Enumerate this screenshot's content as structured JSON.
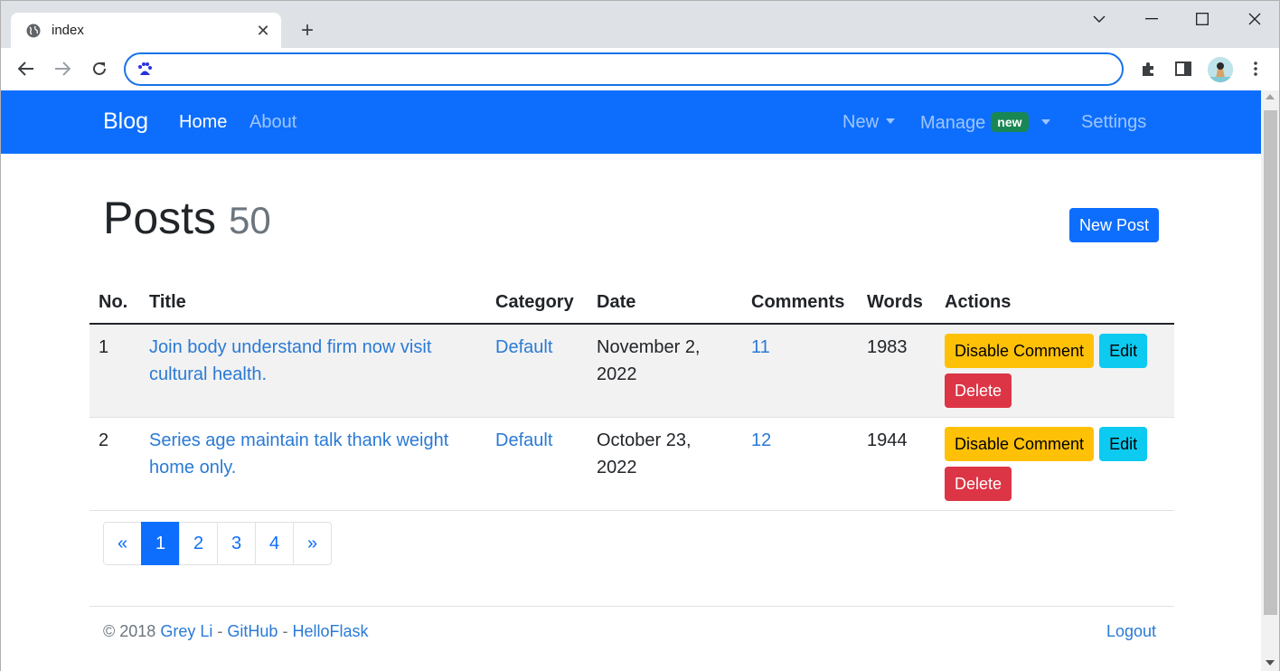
{
  "browser": {
    "tab_title": "index",
    "address_value": "",
    "address_placeholder": ""
  },
  "navbar": {
    "brand": "Blog",
    "home": "Home",
    "about": "About",
    "new": "New",
    "manage": "Manage",
    "manage_badge": "new",
    "settings": "Settings"
  },
  "heading": {
    "title": "Posts",
    "count": "50",
    "new_post_label": "New Post"
  },
  "table": {
    "headers": [
      "No.",
      "Title",
      "Category",
      "Date",
      "Comments",
      "Words",
      "Actions"
    ],
    "rows": [
      {
        "no": "1",
        "title": "Join body understand firm now visit cultural health.",
        "category": "Default",
        "date": "November 2, 2022",
        "comments": "11",
        "words": "1983"
      },
      {
        "no": "2",
        "title": "Series age maintain talk thank weight home only.",
        "category": "Default",
        "date": "October 23, 2022",
        "comments": "12",
        "words": "1944"
      }
    ],
    "actions": {
      "disable_comment": "Disable Comment",
      "edit": "Edit",
      "delete": "Delete"
    }
  },
  "pagination": {
    "prev": "«",
    "pages": [
      "1",
      "2",
      "3",
      "4"
    ],
    "active_page": "1",
    "next": "»"
  },
  "footer": {
    "copyright": "© 2018",
    "author": "Grey Li",
    "sep1": "-",
    "github": "GitHub",
    "sep2": "-",
    "helloflask": "HelloFlask",
    "logout": "Logout"
  },
  "colors": {
    "navbar_bg": "#0d6efd",
    "primary": "#0d6efd",
    "warning": "#ffc107",
    "info": "#0dcaf0",
    "danger": "#dc3545",
    "badge_success": "#198754"
  }
}
